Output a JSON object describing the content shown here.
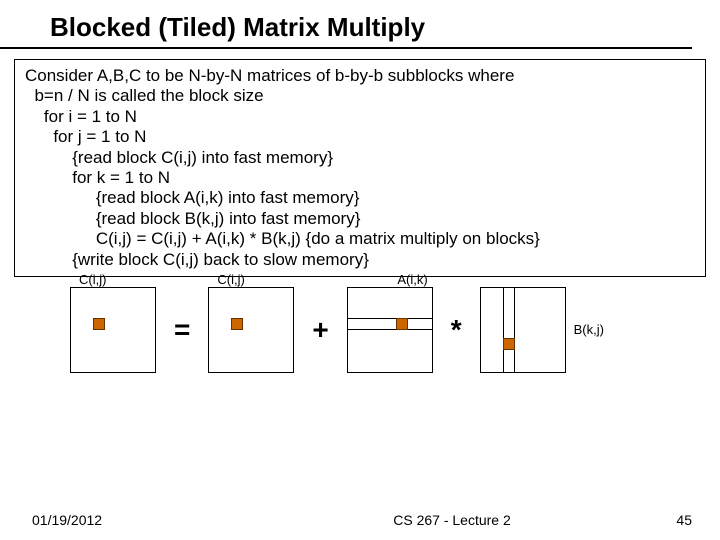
{
  "title": "Blocked (Tiled) Matrix Multiply",
  "code": {
    "l1": "Consider A,B,C to be N-by-N matrices of b-by-b subblocks where",
    "l2": "  b=n / N is called the block size",
    "l3": "    for i = 1 to N",
    "l4": "      for j = 1 to N",
    "l5": "          {read block C(i,j) into fast memory}",
    "l6": "          for k = 1 to N",
    "l7": "               {read block A(i,k) into fast memory}",
    "l8": "               {read block B(k,j) into fast memory}",
    "l9": "               C(i,j) = C(i,j) + A(i,k) * B(k,j) {do a matrix multiply on blocks}",
    "l10": "          {write block C(i,j) back to slow memory}"
  },
  "labels": {
    "c1": "C(i,j)",
    "c2": "C(i,j)",
    "a": "A(i,k)",
    "b": "B(k,j)"
  },
  "ops": {
    "eq": "=",
    "plus": "+",
    "times": "*"
  },
  "footer": {
    "date": "01/19/2012",
    "center": "CS 267 - Lecture 2",
    "page": "45"
  }
}
